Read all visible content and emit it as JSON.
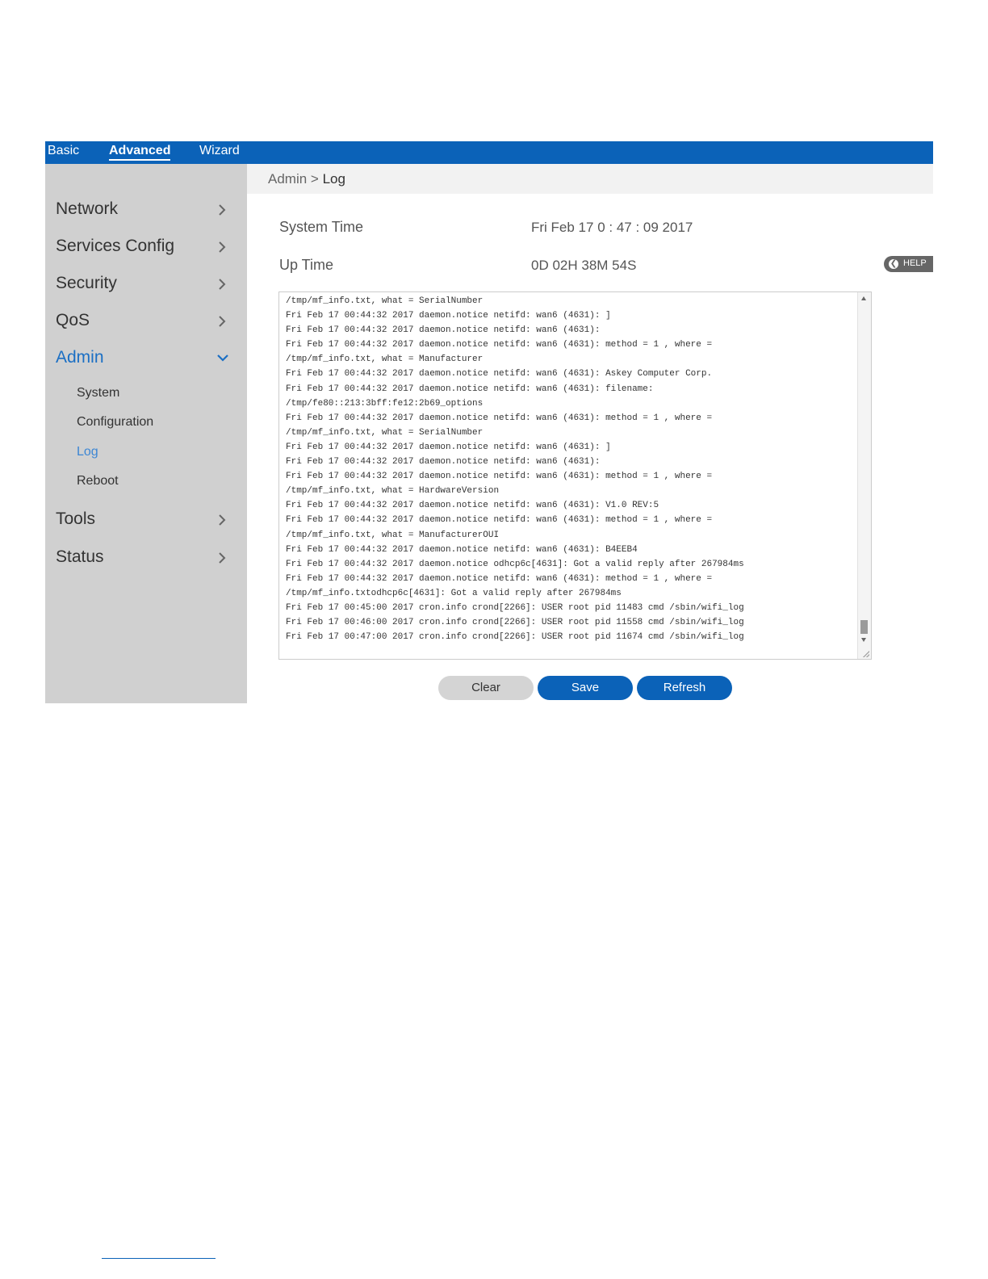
{
  "top_nav": {
    "tabs": [
      {
        "label": "Basic"
      },
      {
        "label": "Advanced"
      },
      {
        "label": "Wizard"
      }
    ]
  },
  "sidebar": {
    "items": [
      {
        "label": "Network"
      },
      {
        "label": "Services Config"
      },
      {
        "label": "Security"
      },
      {
        "label": "QoS"
      },
      {
        "label": "Admin"
      },
      {
        "label": "Tools"
      },
      {
        "label": "Status"
      }
    ],
    "admin_sub": [
      {
        "label": "System"
      },
      {
        "label": "Configuration"
      },
      {
        "label": "Log"
      },
      {
        "label": "Reboot"
      }
    ]
  },
  "breadcrumb": {
    "parent": "Admin",
    "separator": ">",
    "current": "Log"
  },
  "info": {
    "system_time_label": "System Time",
    "system_time_value": "Fri Feb 17 0 : 47 : 09 2017",
    "up_time_label": "Up Time",
    "up_time_value": "0D 02H 38M 54S"
  },
  "help": {
    "label": "HELP"
  },
  "log": {
    "text": "/tmp/mf_info.txt, what = SerialNumber\nFri Feb 17 00:44:32 2017 daemon.notice netifd: wan6 (4631): ]\nFri Feb 17 00:44:32 2017 daemon.notice netifd: wan6 (4631):\nFri Feb 17 00:44:32 2017 daemon.notice netifd: wan6 (4631): method = 1 , where =\n/tmp/mf_info.txt, what = Manufacturer\nFri Feb 17 00:44:32 2017 daemon.notice netifd: wan6 (4631): Askey Computer Corp.\nFri Feb 17 00:44:32 2017 daemon.notice netifd: wan6 (4631): filename:\n/tmp/fe80::213:3bff:fe12:2b69_options\nFri Feb 17 00:44:32 2017 daemon.notice netifd: wan6 (4631): method = 1 , where =\n/tmp/mf_info.txt, what = SerialNumber\nFri Feb 17 00:44:32 2017 daemon.notice netifd: wan6 (4631): ]\nFri Feb 17 00:44:32 2017 daemon.notice netifd: wan6 (4631):\nFri Feb 17 00:44:32 2017 daemon.notice netifd: wan6 (4631): method = 1 , where =\n/tmp/mf_info.txt, what = HardwareVersion\nFri Feb 17 00:44:32 2017 daemon.notice netifd: wan6 (4631): V1.0 REV:5\nFri Feb 17 00:44:32 2017 daemon.notice netifd: wan6 (4631): method = 1 , where =\n/tmp/mf_info.txt, what = ManufacturerOUI\nFri Feb 17 00:44:32 2017 daemon.notice netifd: wan6 (4631): B4EEB4\nFri Feb 17 00:44:32 2017 daemon.notice odhcp6c[4631]: Got a valid reply after 267984ms\nFri Feb 17 00:44:32 2017 daemon.notice netifd: wan6 (4631): method = 1 , where =\n/tmp/mf_info.txtodhcp6c[4631]: Got a valid reply after 267984ms\nFri Feb 17 00:45:00 2017 cron.info crond[2266]: USER root pid 11483 cmd /sbin/wifi_log\nFri Feb 17 00:46:00 2017 cron.info crond[2266]: USER root pid 11558 cmd /sbin/wifi_log\nFri Feb 17 00:47:00 2017 cron.info crond[2266]: USER root pid 11674 cmd /sbin/wifi_log"
  },
  "buttons": {
    "clear": "Clear",
    "save": "Save",
    "refresh": "Refresh"
  },
  "colors": {
    "primary": "#0b62b8",
    "sidebar_bg": "#d0d0d0",
    "active_link": "#1b6fc4"
  }
}
